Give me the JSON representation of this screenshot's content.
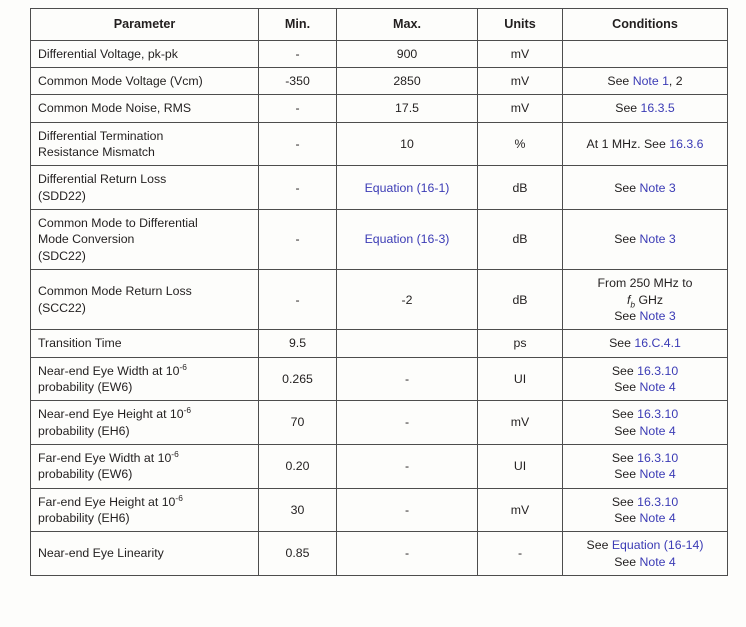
{
  "table": {
    "columns": [
      "Parameter",
      "Min.",
      "Max.",
      "Units",
      "Conditions"
    ],
    "link_color": "#3b3bb5",
    "text_color": "#221f1f",
    "rows": [
      {
        "parameter": "Differential Voltage, pk-pk",
        "min": "-",
        "max": "900",
        "units": "mV",
        "conditions": ""
      },
      {
        "parameter": "Common Mode Voltage (Vcm)",
        "min": "-350",
        "max": "2850",
        "units": "mV",
        "conditions_plain": "See ",
        "conditions_link": "Note 1",
        "conditions_tail": ", 2"
      },
      {
        "parameter": "Common Mode Noise, RMS",
        "min": "-",
        "max": "17.5",
        "units": "mV",
        "conditions_plain": "See ",
        "conditions_link": "16.3.5"
      },
      {
        "parameter_line1": "Differential Termination",
        "parameter_line2": "Resistance Mismatch",
        "min": "-",
        "max": "10",
        "units": "%",
        "conditions_plain": "At 1 MHz. See ",
        "conditions_link": "16.3.6"
      },
      {
        "parameter_line1": "Differential Return Loss",
        "parameter_line2": "(SDD22)",
        "min": "-",
        "max_link": "Equation (16-1)",
        "units": "dB",
        "conditions_plain": "See ",
        "conditions_link": "Note 3"
      },
      {
        "parameter_line1": "Common Mode to Differential",
        "parameter_line2": "Mode Conversion",
        "parameter_line3": "(SDC22)",
        "min": "-",
        "max_link": "Equation (16-3)",
        "units": "dB",
        "conditions_plain": "See ",
        "conditions_link": "Note 3"
      },
      {
        "parameter_line1": "Common Mode Return Loss",
        "parameter_line2": "(SCC22)",
        "min": "-",
        "max": "-2",
        "units": "dB",
        "cond_line1": "From 250 MHz to",
        "cond_line2_prefix": "f",
        "cond_line2_sub": "b",
        "cond_line2_suffix": " GHz",
        "cond_line3_plain": "See ",
        "cond_line3_link": "Note 3"
      },
      {
        "parameter": "Transition Time",
        "min": "9.5",
        "max": "",
        "units": "ps",
        "conditions_plain": "See ",
        "conditions_link": "16.C.4.1"
      },
      {
        "parameter_pre": "Near-end Eye Width at 10",
        "parameter_sup": "-6",
        "parameter_line2": "probability (EW6)",
        "min": "0.265",
        "max": "-",
        "units": "UI",
        "cond_line1_plain": "See ",
        "cond_line1_link": "16.3.10",
        "cond_line2_plain": "See ",
        "cond_line2_link": "Note 4"
      },
      {
        "parameter_pre": "Near-end Eye Height at 10",
        "parameter_sup": "-6",
        "parameter_line2": "probability (EH6)",
        "min": "70",
        "max": "-",
        "units": "mV",
        "cond_line1_plain": "See ",
        "cond_line1_link": "16.3.10",
        "cond_line2_plain": "See ",
        "cond_line2_link": "Note 4"
      },
      {
        "parameter_pre": "Far-end Eye Width at 10",
        "parameter_sup": "-6",
        "parameter_line2": "probability (EW6)",
        "min": "0.20",
        "max": "-",
        "units": "UI",
        "cond_line1_plain": "See ",
        "cond_line1_link": "16.3.10",
        "cond_line2_plain": "See ",
        "cond_line2_link": "Note 4"
      },
      {
        "parameter_pre": "Far-end Eye Height at 10",
        "parameter_sup": "-6",
        "parameter_line2": "probability (EH6)",
        "min": "30",
        "max": "-",
        "units": "mV",
        "cond_line1_plain": "See ",
        "cond_line1_link": "16.3.10",
        "cond_line2_plain": "See ",
        "cond_line2_link": "Note 4"
      },
      {
        "parameter": "Near-end Eye Linearity",
        "min": "0.85",
        "max": "-",
        "units": "-",
        "cond_line1_plain": "See ",
        "cond_line1_link": "Equation (16-14)",
        "cond_line2_plain": "See ",
        "cond_line2_link": "Note 4"
      }
    ]
  }
}
